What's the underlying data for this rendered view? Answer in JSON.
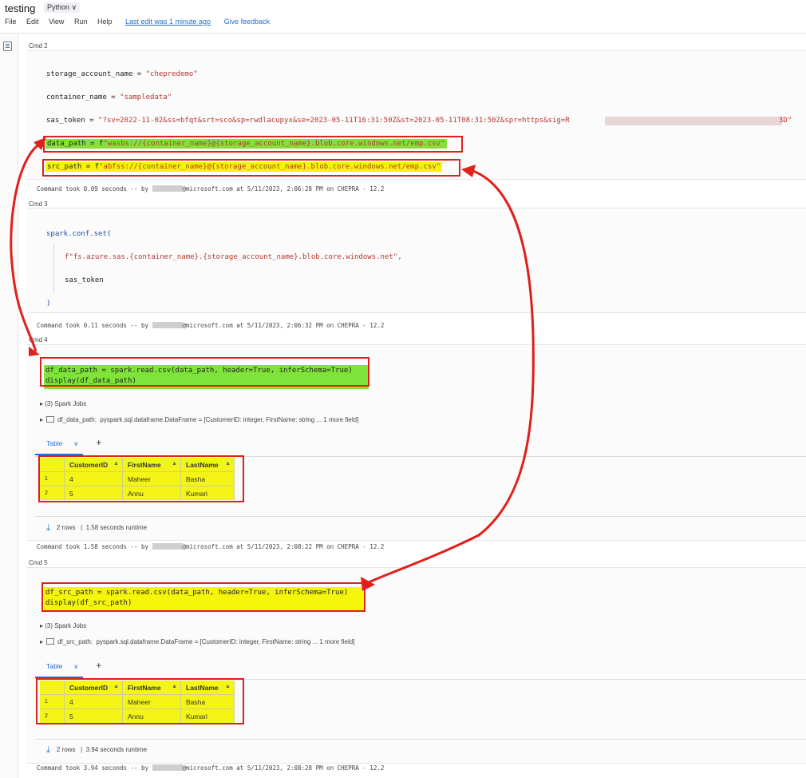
{
  "header": {
    "title": "testing",
    "language": "Python ∨",
    "menu": [
      "File",
      "Edit",
      "View",
      "Run",
      "Help"
    ],
    "last_edit": "Last edit was 1 minute ago",
    "feedback": "Give feedback"
  },
  "cmd2": {
    "label": "Cmd 2",
    "lines": {
      "l1_a": "storage_account_name = ",
      "l1_b": "\"chepredemo\"",
      "l2_a": "container_name = ",
      "l2_b": "\"sampledata\"",
      "l3_a": "sas_token = ",
      "l3_b": "\"?sv=2022-11-02&ss=bfqt&srt=sco&sp=rwdlacupyx&se=2023-05-11T16:31:50Z&st=2023-05-11T08:31:50Z&spr=https&sig=R",
      "l3_c": "3D\"",
      "l4_a": "data_path = f",
      "l4_b": "\"wasbs://{container_name}@{storage_account_name}.blob.core.windows.net/emp.csv\"",
      "l5_a": "src_path = f",
      "l5_b": "\"abfss://{container_name}@{storage_account_name}.blob.core.windows.net/emp.csv\""
    },
    "took_a": "Command took 0.09 seconds -- by ",
    "took_b": "@microsoft.com at 5/11/2023, 2:06:28 PM on CHEPRA - 12.2"
  },
  "cmd3": {
    "label": "Cmd 3",
    "lines": {
      "l1": "spark.conf.set(",
      "l2": "f\"fs.azure.sas.{container_name}.{storage_account_name}.blob.core.windows.net\",",
      "l3": "sas_token",
      "l4": ")"
    },
    "took_a": "Command took 0.11 seconds -- by ",
    "took_b": "@microsoft.com at 5/11/2023, 2:06:32 PM on CHEPRA - 12.2"
  },
  "cmd4": {
    "label": "Cmd 4",
    "code_l1": "df_data_path = spark.read.csv(data_path, header=True, inferSchema=True)",
    "code_l2": "display(df_data_path)",
    "jobs": "▸ (3) Spark Jobs",
    "df_name": "df_data_path:",
    "df_type": "pyspark.sql.dataframe.DataFrame = [CustomerID: integer, FirstName: string ... 1 more field]",
    "tab": "Table",
    "table": {
      "columns": [
        "CustomerID",
        "FirstName",
        "LastName"
      ],
      "rows": [
        [
          "1",
          "4",
          "Maheer",
          "Basha"
        ],
        [
          "2",
          "5",
          "Annu",
          "Kumari"
        ]
      ]
    },
    "rows_count": "2 rows",
    "runtime": "|  1.58 seconds runtime",
    "took_a": "Command took 1.58 seconds -- by ",
    "took_b": "@microsoft.com at 5/11/2023, 2:08:22 PM on CHEPRA - 12.2"
  },
  "cmd5": {
    "label": "Cmd 5",
    "code_l1": "df_src_path = spark.read.csv(data_path, header=True, inferSchema=True)",
    "code_l2": "display(df_src_path)",
    "jobs": "▸ (3) Spark Jobs",
    "df_name": "df_src_path:",
    "df_type": "pyspark.sql.dataframe.DataFrame = [CustomerID: integer, FirstName: string ... 1 more field]",
    "tab": "Table",
    "table": {
      "columns": [
        "CustomerID",
        "FirstName",
        "LastName"
      ],
      "rows": [
        [
          "1",
          "4",
          "Maheer",
          "Basha"
        ],
        [
          "2",
          "5",
          "Annu",
          "Kumari"
        ]
      ]
    },
    "rows_count": "2 rows",
    "runtime": "|  3.94 seconds runtime",
    "took_a": "Command took 3.94 seconds -- by ",
    "took_b": "@microsoft.com at 5/11/2023, 2:08:28 PM on CHEPRA - 12.2"
  },
  "colors": {
    "highlight_green": "#7ee43a",
    "highlight_yellow": "#f5f50a",
    "annotation_red": "#e0201a",
    "link_blue": "#1f6fd1"
  }
}
